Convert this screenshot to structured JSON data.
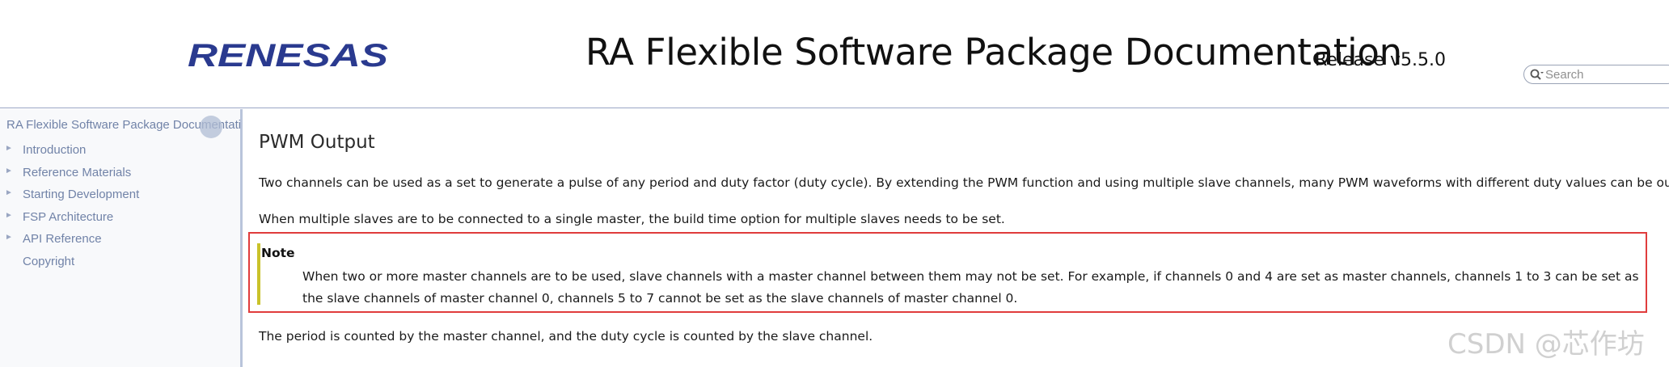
{
  "header": {
    "logo_text": "RENESAS",
    "project_title": "RA Flexible Software Package Documentation",
    "project_number": "Release v5.5.0",
    "search": {
      "placeholder": "Search",
      "value": "",
      "icon": "search-icon"
    },
    "colors": {
      "logo": "#2a3a8f"
    }
  },
  "sidebar": {
    "root_label": "RA Flexible Software Package Documentation",
    "sync_icon": "sync-button",
    "items": [
      {
        "label": "Introduction",
        "has_arrow": true
      },
      {
        "label": "Reference Materials",
        "has_arrow": true
      },
      {
        "label": "Starting Development",
        "has_arrow": true
      },
      {
        "label": "FSP Architecture",
        "has_arrow": true
      },
      {
        "label": "API Reference",
        "has_arrow": true
      },
      {
        "label": "Copyright",
        "has_arrow": false
      }
    ],
    "arrow_glyph": "►",
    "colors": {
      "text": "#7183a8",
      "background": "#f8f9fb"
    }
  },
  "content": {
    "title": "PWM Output",
    "paragraph_1": "Two channels can be used as a set to generate a pulse of any period and duty factor (duty cycle). By extending the PWM function and using multiple slave channels, many PWM waveforms with different duty values can be output.",
    "paragraph_2": "When multiple slaves are to be connected to a single master, the build time option for multiple slaves needs to be set.",
    "note": {
      "title": "Note",
      "text": "When two or more master channels are to be used, slave channels with a master channel between them may not be set. For example, if channels 0 and 4 are set as master channels, channels 1 to 3 can be set as the slave channels of master channel 0, channels 5 to 7 cannot be set as the slave channels of master channel 0.",
      "colors": {
        "highlight_border": "#e03c3c",
        "bar": "#c9c22a"
      }
    },
    "paragraph_3": "The period is counted by the master channel, and the duty cycle is counted by the slave channel."
  },
  "watermark": "CSDN @芯作坊"
}
